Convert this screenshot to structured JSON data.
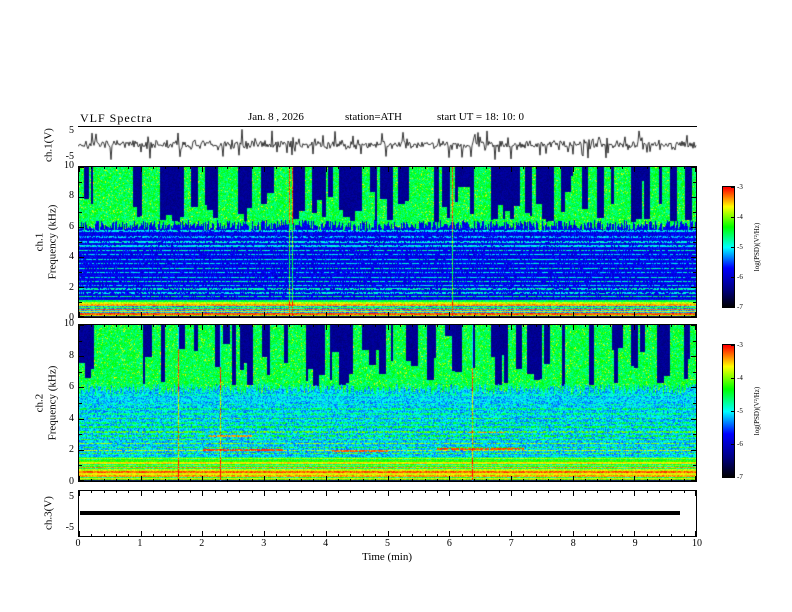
{
  "header": {
    "title": "VLF  Spectra",
    "date": "Jan. 8  , 2026",
    "station": "station=ATH",
    "start_ut": "start UT =   18: 10: 0"
  },
  "axes": {
    "x_label": "Time  (min)",
    "x_ticks": [
      "0",
      "1",
      "2",
      "3",
      "4",
      "5",
      "6",
      "7",
      "8",
      "9",
      "10"
    ],
    "ch1v_label": "ch.1(V)",
    "ch1_label": "ch.1",
    "ch2_label": "ch.2",
    "ch3v_label": "ch.3(V)",
    "freq_label": "Frequency  (kHz)",
    "freq_ticks": [
      "10",
      "8",
      "6",
      "4",
      "2",
      "0"
    ],
    "volt_ticks": [
      "5",
      "-5"
    ]
  },
  "colorbar": {
    "label": "log(PSD)(V²/Hz)",
    "ticks": [
      "-3",
      "-4",
      "-5",
      "-6",
      "-7"
    ],
    "min": -7,
    "max": -3
  },
  "chart_data": [
    {
      "type": "line",
      "panel": "ch.1(V)",
      "xlim": [
        0,
        10
      ],
      "xlabel": "Time (min)",
      "ylim": [
        -5,
        5
      ],
      "ylabel": "ch.1(V)",
      "description": "Raw ch.1 voltage: broadband noise centered on 0 V with frequent impulsive sferic spikes reaching about +/-4 V across the full 10 min record."
    },
    {
      "type": "heatmap",
      "panel": "ch.1 spectrogram",
      "xlim": [
        0,
        10
      ],
      "ylim": [
        0,
        10
      ],
      "xlabel": "Time (min)",
      "ylabel": "Frequency (kHz)",
      "zlabel": "log(PSD)(V²/Hz)",
      "zlim": [
        -7,
        -3
      ],
      "features": [
        "6-10 kHz: continuous green/yellow emission band (PSD ~ -4.5) broken by many narrow dark-blue vertical dropouts",
        "1-6 kHz: low-PSD blue background (~ -6.3) crossed by many thin horizontal interference lines (~ -5)",
        "0-1 kHz: intense yellow/red horizontal bands (PSD ~ -3.5)",
        "occasional bright cyan vertical streaks spanning all frequencies"
      ]
    },
    {
      "type": "heatmap",
      "panel": "ch.2 spectrogram",
      "xlim": [
        0,
        10
      ],
      "ylim": [
        0,
        10
      ],
      "xlabel": "Time (min)",
      "ylabel": "Frequency (kHz)",
      "zlabel": "log(PSD)(V²/Hz)",
      "zlim": [
        -7,
        -3
      ],
      "features": [
        "6-10 kHz: green emission band (PSD ~ -4.5) with dense dark-blue vertical dropouts",
        "2-6 kHz: mottled cyan/green background (~ -5) with yellow horizontal interference lines",
        "1-3 kHz: strong yellow/orange bands with intermittent red segments (PSD ~ -3.2)",
        "0-1.5 kHz: bright green/yellow/red bands"
      ]
    },
    {
      "type": "line",
      "panel": "ch.3(V)",
      "xlim": [
        0,
        10
      ],
      "ylim": [
        -5,
        5
      ],
      "ylabel": "ch.3(V)",
      "description": "Constant flat trace at ~0 V (thick black line, no signal on channel 3)."
    }
  ]
}
